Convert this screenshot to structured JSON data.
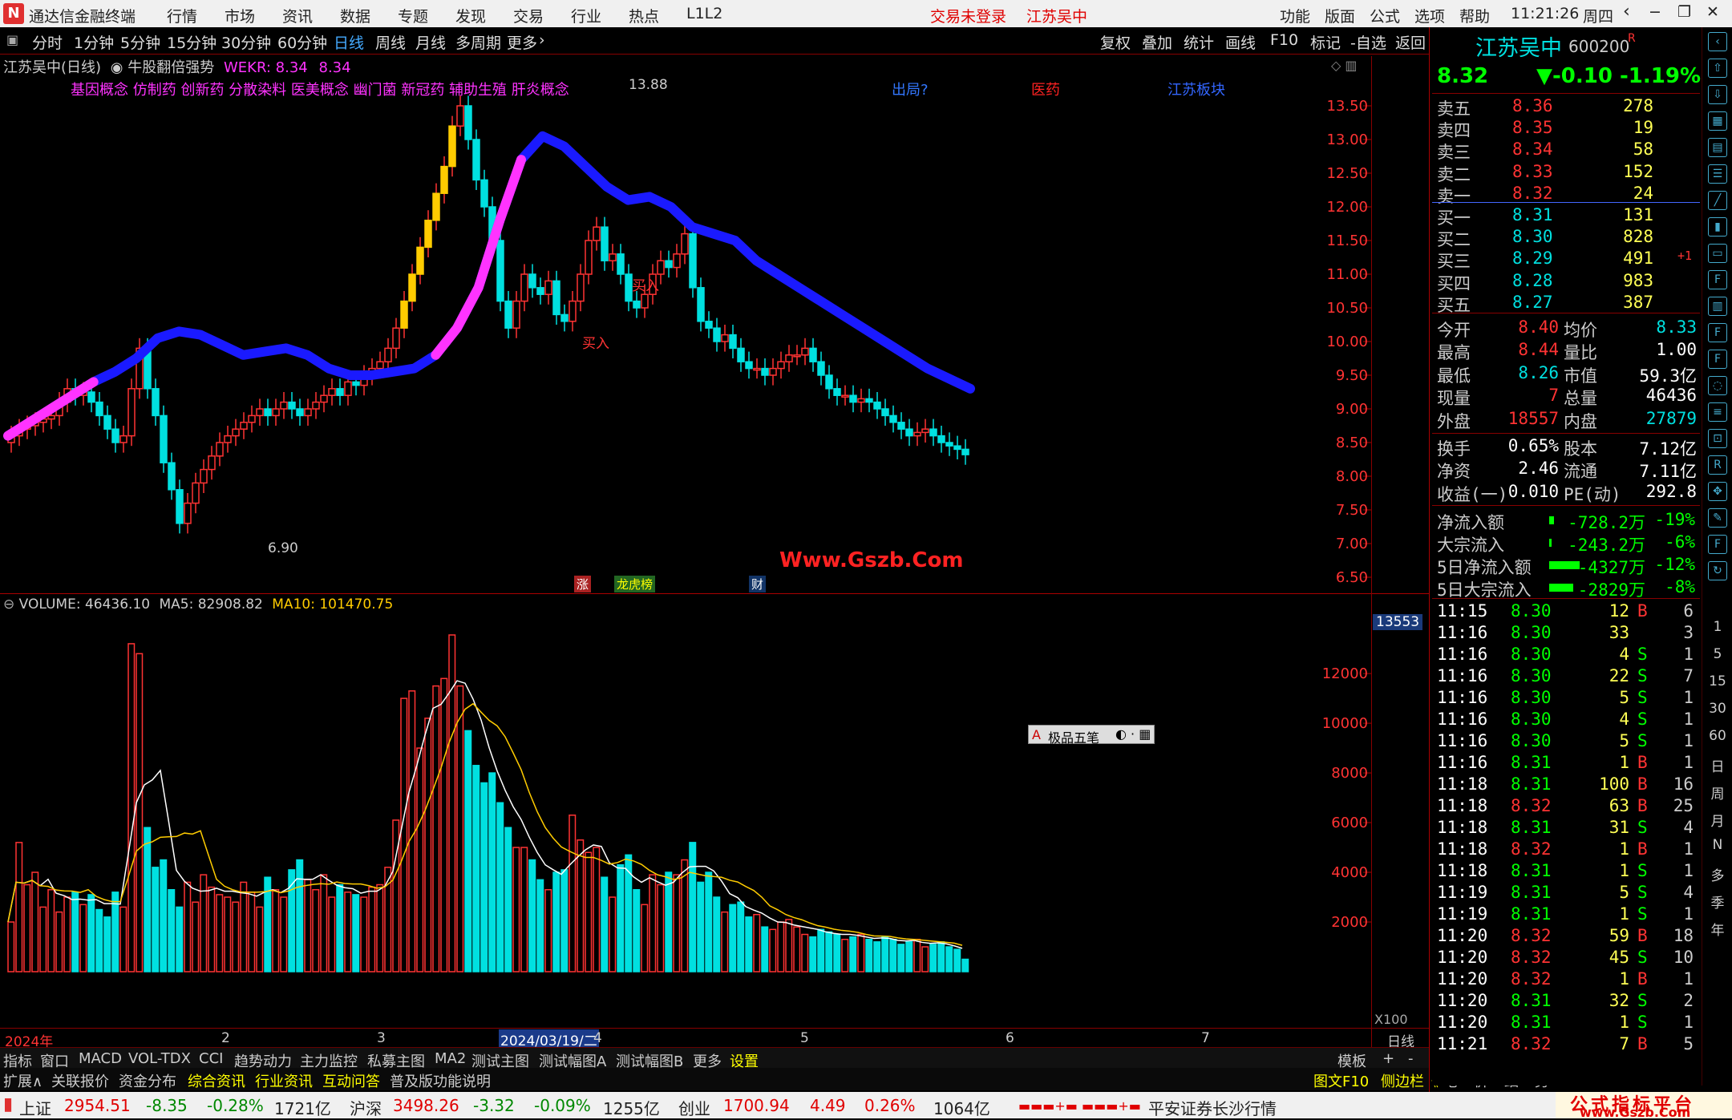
{
  "titlebar": {
    "app_name": "通达信金融终端",
    "menus": [
      "行情",
      "市场",
      "资讯",
      "数据",
      "专题",
      "发现",
      "交易",
      "行业",
      "热点",
      "L1L2"
    ],
    "login_status": "交易未登录",
    "stock_name": "江苏吴中",
    "right_menus": [
      "功能",
      "版面",
      "公式",
      "选项",
      "帮助"
    ],
    "time": "11:21:26",
    "weekday": "周四"
  },
  "periods": {
    "items": [
      "分时",
      "1分钟",
      "5分钟",
      "15分钟",
      "30分钟",
      "60分钟",
      "日线",
      "周线",
      "月线",
      "多周期",
      "更多"
    ],
    "active": "日线",
    "tools": [
      "复权",
      "叠加",
      "统计",
      "画线",
      "F10",
      "标记",
      "-自选",
      "返回"
    ]
  },
  "chart_header": {
    "stock": "江苏吴中(日线)",
    "indicator": "牛股翻倍强势",
    "wekr": "WEKR: 8.34",
    "wekr2": "8.34",
    "concepts": "基因概念 仿制药 创新药 分散染料 医美概念 幽门菌 新冠药 辅助生殖 肝炎概念",
    "tag1": "出局?",
    "tag2": "医药",
    "tag3": "江苏板块",
    "high_label": "13.88",
    "low_label": "6.90",
    "buy_label": "买入",
    "watermark": "Www.Gszb.Com",
    "markers": [
      "涨",
      "龙虎榜",
      "财"
    ]
  },
  "price_axis": [
    "13.50",
    "13.00",
    "12.50",
    "12.00",
    "11.50",
    "11.00",
    "10.50",
    "10.00",
    "9.50",
    "9.00",
    "8.50",
    "8.00",
    "7.50",
    "7.00",
    "6.50"
  ],
  "volume_header": {
    "label": "VOLUME: 46436.10",
    "ma5": "MA5: 82908.82",
    "ma10": "MA10: 101470.75",
    "max": "13553",
    "unit": "X100",
    "widget": "极品五笔"
  },
  "volume_axis": [
    "12000",
    "10000",
    "8000",
    "6000",
    "4000",
    "2000"
  ],
  "date_axis": {
    "labels": [
      "2024年",
      "2",
      "3",
      "2024/03/19/二",
      "4",
      "5",
      "6",
      "7"
    ],
    "period": "日线"
  },
  "bottom_tabs": [
    "指标",
    "窗口",
    "MACD",
    "VOL-TDX",
    "CCI",
    "趋势动力",
    "主力监控",
    "私募主图",
    "MA2",
    "测试主图",
    "测试幅图A",
    "测试幅图B",
    "更多",
    "设置"
  ],
  "bottom_right": [
    "模板",
    "+",
    "-"
  ],
  "bottom_tabs2": [
    "扩展∧",
    "关联报价",
    "资金分布",
    "综合资讯",
    "行业资讯",
    "互动问答",
    "普及版功能说明"
  ],
  "bottom_right2": [
    "图文F10",
    "侧边栏《",
    "笔",
    "价",
    "细",
    "势"
  ],
  "quote": {
    "name": "江苏吴中",
    "code": "600200",
    "flag": "R",
    "price": "8.32",
    "change": "▼-0.10",
    "pct": "-1.19%",
    "asks": [
      {
        "label": "卖五",
        "price": "8.36",
        "vol": "278"
      },
      {
        "label": "卖四",
        "price": "8.35",
        "vol": "19"
      },
      {
        "label": "卖三",
        "price": "8.34",
        "vol": "58"
      },
      {
        "label": "卖二",
        "price": "8.33",
        "vol": "152"
      },
      {
        "label": "卖一",
        "price": "8.32",
        "vol": "24"
      }
    ],
    "bids": [
      {
        "label": "买一",
        "price": "8.31",
        "vol": "131",
        "extra": ""
      },
      {
        "label": "买二",
        "price": "8.30",
        "vol": "828",
        "extra": ""
      },
      {
        "label": "买三",
        "price": "8.29",
        "vol": "491",
        "extra": "+1"
      },
      {
        "label": "买四",
        "price": "8.28",
        "vol": "983",
        "extra": ""
      },
      {
        "label": "买五",
        "price": "8.27",
        "vol": "387",
        "extra": ""
      }
    ],
    "stats": [
      {
        "l1": "今开",
        "v1": "8.40",
        "l2": "均价",
        "v2": "8.33"
      },
      {
        "l1": "最高",
        "v1": "8.44",
        "l2": "量比",
        "v2": "1.00"
      },
      {
        "l1": "最低",
        "v1": "8.26",
        "l2": "市值",
        "v2": "59.3亿"
      },
      {
        "l1": "现量",
        "v1": "7",
        "l2": "总量",
        "v2": "46436"
      },
      {
        "l1": "外盘",
        "v1": "18557",
        "l2": "内盘",
        "v2": "27879"
      }
    ],
    "stats2": [
      {
        "l1": "换手",
        "v1": "0.65%",
        "l2": "股本",
        "v2": "7.12亿"
      },
      {
        "l1": "净资",
        "v1": "2.46",
        "l2": "流通",
        "v2": "7.11亿"
      },
      {
        "l1": "收益(一)",
        "v1": "0.010",
        "l2": "PE(动)",
        "v2": "292.8"
      }
    ],
    "flows": [
      {
        "label": "净流入额",
        "value": "-728.2万",
        "pct": "-19%"
      },
      {
        "label": "大宗流入",
        "value": "-243.2万",
        "pct": "-6%"
      },
      {
        "label": "5日净流入额",
        "value": "-4327万",
        "pct": "-12%"
      },
      {
        "label": "5日大宗流入",
        "value": "-2829万",
        "pct": "-8%"
      }
    ],
    "ticks": [
      {
        "t": "11:15",
        "p": "8.30",
        "v": "12",
        "s": "B",
        "n": "6"
      },
      {
        "t": "11:16",
        "p": "8.30",
        "v": "33",
        "s": "",
        "n": "3"
      },
      {
        "t": "11:16",
        "p": "8.30",
        "v": "4",
        "s": "S",
        "n": "1"
      },
      {
        "t": "11:16",
        "p": "8.30",
        "v": "22",
        "s": "S",
        "n": "7"
      },
      {
        "t": "11:16",
        "p": "8.30",
        "v": "5",
        "s": "S",
        "n": "1"
      },
      {
        "t": "11:16",
        "p": "8.30",
        "v": "4",
        "s": "S",
        "n": "1"
      },
      {
        "t": "11:16",
        "p": "8.30",
        "v": "5",
        "s": "S",
        "n": "1"
      },
      {
        "t": "11:16",
        "p": "8.31",
        "v": "1",
        "s": "B",
        "n": "1"
      },
      {
        "t": "11:18",
        "p": "8.31",
        "v": "100",
        "s": "B",
        "n": "16"
      },
      {
        "t": "11:18",
        "p": "8.32",
        "v": "63",
        "s": "B",
        "n": "25"
      },
      {
        "t": "11:18",
        "p": "8.31",
        "v": "31",
        "s": "S",
        "n": "4"
      },
      {
        "t": "11:18",
        "p": "8.32",
        "v": "1",
        "s": "B",
        "n": "1"
      },
      {
        "t": "11:18",
        "p": "8.31",
        "v": "1",
        "s": "S",
        "n": "1"
      },
      {
        "t": "11:19",
        "p": "8.31",
        "v": "5",
        "s": "S",
        "n": "4"
      },
      {
        "t": "11:19",
        "p": "8.31",
        "v": "1",
        "s": "S",
        "n": "1"
      },
      {
        "t": "11:20",
        "p": "8.32",
        "v": "59",
        "s": "B",
        "n": "18"
      },
      {
        "t": "11:20",
        "p": "8.32",
        "v": "45",
        "s": "S",
        "n": "10"
      },
      {
        "t": "11:20",
        "p": "8.32",
        "v": "1",
        "s": "B",
        "n": "1"
      },
      {
        "t": "11:20",
        "p": "8.31",
        "v": "32",
        "s": "S",
        "n": "2"
      },
      {
        "t": "11:20",
        "p": "8.31",
        "v": "1",
        "s": "S",
        "n": "1"
      },
      {
        "t": "11:21",
        "p": "8.32",
        "v": "7",
        "s": "B",
        "n": "5"
      }
    ]
  },
  "side_periods": [
    "1",
    "5",
    "15",
    "30",
    "60",
    "日",
    "周",
    "月",
    "N",
    "多",
    "季",
    "年"
  ],
  "statusbar": {
    "sh_name": "上证",
    "sh_val": "2954.51",
    "sh_chg": "-8.35",
    "sh_pct": "-0.28%",
    "sh_amt": "1721亿",
    "hs_name": "沪深",
    "hs_val": "3498.26",
    "hs_chg": "-3.32",
    "hs_pct": "-0.09%",
    "hs_amt": "1255亿",
    "cy_name": "创业",
    "cy_val": "1700.94",
    "cy_chg": "4.49",
    "cy_pct": "0.26%",
    "cy_amt": "1064亿",
    "broker": "平安证券长沙行情",
    "brand": "公式指标平台",
    "brand_url": "www.Gszb.Com"
  },
  "colors": {
    "up": "#ff3333",
    "down": "#00e0e0",
    "ma_blue": "#1a1aff",
    "ma_magenta": "#ff33ff",
    "yellow": "#ffcc00"
  }
}
